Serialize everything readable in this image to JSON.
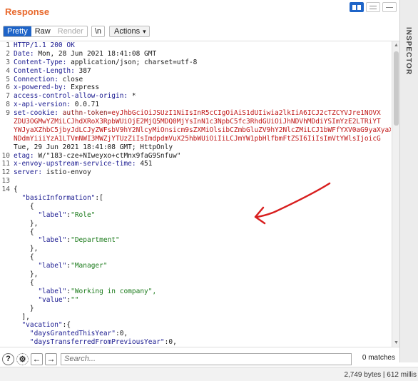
{
  "panel": {
    "title": "Response"
  },
  "toolbar": {
    "pretty": "Pretty",
    "raw": "Raw",
    "render": "Render",
    "newline": "\\n",
    "actions": "Actions"
  },
  "sidebar": {
    "inspector": "INSPECTOR"
  },
  "editor": {
    "line_numbers": [
      "1",
      "2",
      "3",
      "4",
      "5",
      "6",
      "7",
      "8",
      "9",
      "",
      "",
      "",
      "",
      "10",
      "11",
      "12",
      "13",
      "14",
      "",
      "",
      "",
      "",
      "",
      "",
      "",
      "",
      "",
      "",
      "",
      "",
      "",
      "",
      "",
      "",
      "",
      ""
    ],
    "headers": [
      {
        "name": "HTTP/1.1 200 OK",
        "value": ""
      },
      {
        "name": "Date:",
        "value": " Mon, 28 Jun 2021 18:41:08 GMT"
      },
      {
        "name": "Content-Type:",
        "value": " application/json; charset=utf-8"
      },
      {
        "name": "Content-Length:",
        "value": " 387"
      },
      {
        "name": "Connection:",
        "value": " close"
      },
      {
        "name": "x-powered-by:",
        "value": " Express"
      },
      {
        "name": "access-control-allow-origin:",
        "value": " *"
      },
      {
        "name": "x-api-version:",
        "value": " 0.0.71"
      }
    ],
    "cookie": {
      "name": "set-cookie:",
      "key": " authn-token=",
      "lines": [
        "eyJhbGciOiJSUzI1NiIsInR5cCIgOiAiS1dUIiwia2lkIiA6ICJ2cTZCYVJre1NOVX",
        "ZDU3OGMwYZMiLCJhdXRoX3RpbWUiOjE2MjQ5MDQ0MjYsInN1c3NpbC5fc3RhdGUiOiJhNDVhMDdiYSImYzE2LTRiYT",
        "YWJyaXZhbC5jbyJdLCJyZWFsbV9hY2NlcyMiOnsicm9sZXMiOlsibCZmbGluZV9hY2NlcZMiLCJ1bWFfYXV0aG9yaXyaX",
        "NDdmYiiiYzA1LTVmNWI3MWZjYTUzZiIsImdpdmVuX25hbWUiOiIiLCJmYW1pbHlfbmFtZSI6IiIsImVtYWlsIjoicG"
      ],
      "tail": "Tue, 29 Jun 2021 18:41:08 GMT; HttpOnly"
    },
    "headers2": [
      {
        "name": "etag:",
        "value": " W/\"183-cze+NIweyxo+ctMnx9faG9Snfuw\""
      },
      {
        "name": "x-envoy-upstream-service-time:",
        "value": " 451"
      },
      {
        "name": "server:",
        "value": " istio-envoy"
      }
    ],
    "json_lines": [
      [
        "{",
        "",
        "",
        ""
      ],
      [
        "  ",
        "\"basicInformation\"",
        ":[",
        ""
      ],
      [
        "    {",
        "",
        "",
        ""
      ],
      [
        "      ",
        "\"label\"",
        ":",
        "\"Role\""
      ],
      [
        "    },",
        "",
        "",
        ""
      ],
      [
        "    {",
        "",
        "",
        ""
      ],
      [
        "      ",
        "\"label\"",
        ":",
        "\"Department\""
      ],
      [
        "    },",
        "",
        "",
        ""
      ],
      [
        "    {",
        "",
        "",
        ""
      ],
      [
        "      ",
        "\"label\"",
        ":",
        "\"Manager\""
      ],
      [
        "    },",
        "",
        "",
        ""
      ],
      [
        "    {",
        "",
        "",
        ""
      ],
      [
        "      ",
        "\"label\"",
        ":",
        "\"Working in company\","
      ],
      [
        "      ",
        "\"value\"",
        ":",
        "\"\""
      ],
      [
        "    }",
        "",
        "",
        ""
      ],
      [
        "  ],",
        "",
        "",
        ""
      ],
      [
        "  ",
        "\"vacation\"",
        ":{",
        ""
      ],
      [
        "    ",
        "\"daysGrantedThisYear\"",
        ":",
        "0,"
      ],
      [
        "    ",
        "\"daysTransferredFromPreviousYear\"",
        ":",
        "0,"
      ]
    ]
  },
  "search": {
    "placeholder": "Search...",
    "matches": "0 matches"
  },
  "status": {
    "text": "2,749 bytes | 612 millis"
  },
  "colors": {
    "accent": "#e8672a",
    "selected": "#1e64c8",
    "annotation": "#d81e1e"
  }
}
